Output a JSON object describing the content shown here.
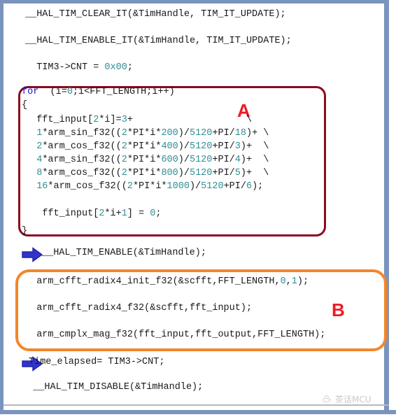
{
  "colors": {
    "frame": "#7a94be",
    "box_a_border": "#8a0b1e",
    "box_b_border": "#f2862b",
    "tag_red": "#ee1b24",
    "keyword_blue": "#1414cc",
    "number_teal": "#2f8f94",
    "code_black": "#1a1a1a",
    "arrow_blue": "#3333cc",
    "watermark_gray": "#9c9c9c"
  },
  "code": {
    "top_lines": [
      {
        "text": "__HAL_TIM_CLEAR_IT(&TimHandle, TIM_IT_UPDATE);"
      },
      {
        "text": "__HAL_TIM_ENABLE_IT(&TimHandle, TIM_IT_UPDATE);"
      }
    ],
    "tim_reset": {
      "prefix": "  TIM3->CNT = ",
      "value": "0x00",
      "suffix": ";"
    },
    "block_a": {
      "line_for_kw": "for",
      "line_for_rest_a": "  (i=",
      "line_for_num0": "0",
      "line_for_rest_b": ";i<FFT_LENGTH;i++)",
      "open_brace": "{",
      "close_brace": "}",
      "body": [
        {
          "segments": [
            {
              "t": "  fft_input[",
              "c": "black"
            },
            {
              "t": "2",
              "c": "teal"
            },
            {
              "t": "*i]=",
              "c": "black"
            },
            {
              "t": "3",
              "c": "teal"
            },
            {
              "t": "+",
              "c": "black"
            },
            {
              "t": "                    \\",
              "c": "black"
            }
          ]
        },
        {
          "segments": [
            {
              "t": "  ",
              "c": "black"
            },
            {
              "t": "1",
              "c": "teal"
            },
            {
              "t": "*arm_sin_f32((",
              "c": "black"
            },
            {
              "t": "2",
              "c": "teal"
            },
            {
              "t": "*PI*i*",
              "c": "black"
            },
            {
              "t": "200",
              "c": "teal"
            },
            {
              "t": ")/",
              "c": "black"
            },
            {
              "t": "5120",
              "c": "teal"
            },
            {
              "t": "+PI/",
              "c": "black"
            },
            {
              "t": "18",
              "c": "teal"
            },
            {
              "t": ")+ \\",
              "c": "black"
            }
          ]
        },
        {
          "segments": [
            {
              "t": "  ",
              "c": "black"
            },
            {
              "t": "2",
              "c": "teal"
            },
            {
              "t": "*arm_cos_f32((",
              "c": "black"
            },
            {
              "t": "2",
              "c": "teal"
            },
            {
              "t": "*PI*i*",
              "c": "black"
            },
            {
              "t": "400",
              "c": "teal"
            },
            {
              "t": ")/",
              "c": "black"
            },
            {
              "t": "5120",
              "c": "teal"
            },
            {
              "t": "+PI/",
              "c": "black"
            },
            {
              "t": "3",
              "c": "teal"
            },
            {
              "t": ")+  \\",
              "c": "black"
            }
          ]
        },
        {
          "segments": [
            {
              "t": "  ",
              "c": "black"
            },
            {
              "t": "4",
              "c": "teal"
            },
            {
              "t": "*arm_sin_f32((",
              "c": "black"
            },
            {
              "t": "2",
              "c": "teal"
            },
            {
              "t": "*PI*i*",
              "c": "black"
            },
            {
              "t": "600",
              "c": "teal"
            },
            {
              "t": ")/",
              "c": "black"
            },
            {
              "t": "5120",
              "c": "teal"
            },
            {
              "t": "+PI/",
              "c": "black"
            },
            {
              "t": "4",
              "c": "teal"
            },
            {
              "t": ")+  \\",
              "c": "black"
            }
          ]
        },
        {
          "segments": [
            {
              "t": "  ",
              "c": "black"
            },
            {
              "t": "8",
              "c": "teal"
            },
            {
              "t": "*arm_cos_f32((",
              "c": "black"
            },
            {
              "t": "2",
              "c": "teal"
            },
            {
              "t": "*PI*i*",
              "c": "black"
            },
            {
              "t": "800",
              "c": "teal"
            },
            {
              "t": ")/",
              "c": "black"
            },
            {
              "t": "5120",
              "c": "teal"
            },
            {
              "t": "+PI/",
              "c": "black"
            },
            {
              "t": "5",
              "c": "teal"
            },
            {
              "t": ")+  \\",
              "c": "black"
            }
          ]
        },
        {
          "segments": [
            {
              "t": "  ",
              "c": "black"
            },
            {
              "t": "16",
              "c": "teal"
            },
            {
              "t": "*arm_cos_f32((",
              "c": "black"
            },
            {
              "t": "2",
              "c": "teal"
            },
            {
              "t": "*PI*i*",
              "c": "black"
            },
            {
              "t": "1000",
              "c": "teal"
            },
            {
              "t": ")/",
              "c": "black"
            },
            {
              "t": "5120",
              "c": "teal"
            },
            {
              "t": "+PI/",
              "c": "black"
            },
            {
              "t": "6",
              "c": "teal"
            },
            {
              "t": ");",
              "c": "black"
            }
          ]
        },
        {
          "segments": [
            {
              "t": "   fft_input[",
              "c": "black"
            },
            {
              "t": "2",
              "c": "teal"
            },
            {
              "t": "*i+",
              "c": "black"
            },
            {
              "t": "1",
              "c": "teal"
            },
            {
              "t": "] = ",
              "c": "black"
            },
            {
              "t": "0",
              "c": "teal"
            },
            {
              "t": ";",
              "c": "black"
            }
          ]
        }
      ]
    },
    "tim_enable": "__HAL_TIM_ENABLE(&TimHandle);",
    "block_b": [
      {
        "segments": [
          {
            "t": "  arm_cfft_radix4_init_f32(&scfft,FFT_LENGTH,",
            "c": "black"
          },
          {
            "t": "0",
            "c": "teal"
          },
          {
            "t": ",",
            "c": "black"
          },
          {
            "t": "1",
            "c": "teal"
          },
          {
            "t": ");",
            "c": "black"
          }
        ]
      },
      {
        "segments": [
          {
            "t": "  arm_cfft_radix4_f32(&scfft,fft_input);",
            "c": "black"
          }
        ]
      },
      {
        "segments": [
          {
            "t": "  arm_cmplx_mag_f32(fft_input,fft_output,FFT_LENGTH);",
            "c": "black"
          }
        ]
      }
    ],
    "time_elapsed": "Time_elapsed= TIM3->CNT;",
    "tim_disable": "  __HAL_TIM_DISABLE(&TimHandle);"
  },
  "annotations": {
    "tag_a": "A",
    "tag_b": "B"
  },
  "watermark": {
    "logo": "teacup-icon",
    "text": "茶话MCU"
  }
}
